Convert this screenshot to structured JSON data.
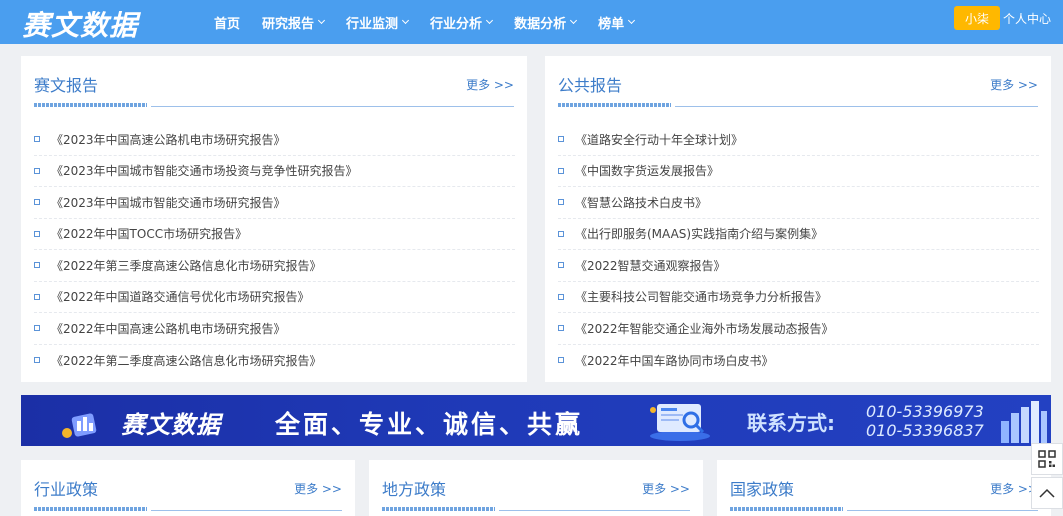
{
  "header": {
    "logo": "赛文数据",
    "nav": [
      {
        "label": "首页",
        "dropdown": false
      },
      {
        "label": "研究报告",
        "dropdown": true
      },
      {
        "label": "行业监测",
        "dropdown": true
      },
      {
        "label": "行业分析",
        "dropdown": true
      },
      {
        "label": "数据分析",
        "dropdown": true
      },
      {
        "label": "榜单",
        "dropdown": true
      }
    ],
    "user_button": "小柒",
    "user_center": "个人中心"
  },
  "sections": {
    "saiwen": {
      "title": "赛文报告",
      "more": "更多 >>",
      "items": [
        "《2023年中国高速公路机电市场研究报告》",
        "《2023年中国城市智能交通市场投资与竞争性研究报告》",
        "《2023年中国城市智能交通市场研究报告》",
        "《2022年中国TOCC市场研究报告》",
        "《2022年第三季度高速公路信息化市场研究报告》",
        "《2022年中国道路交通信号优化市场研究报告》",
        "《2022年中国高速公路机电市场研究报告》",
        "《2022年第二季度高速公路信息化市场研究报告》"
      ]
    },
    "public": {
      "title": "公共报告",
      "more": "更多 >>",
      "items": [
        "《道路安全行动十年全球计划》",
        "《中国数字货运发展报告》",
        "《智慧公路技术白皮书》",
        "《出行即服务(MAAS)实践指南介绍与案例集》",
        "《2022智慧交通观察报告》",
        "《主要科技公司智能交通市场竞争力分析报告》",
        "《2022年智能交通企业海外市场发展动态报告》",
        "《2022年中国车路协同市场白皮书》"
      ]
    },
    "industry_policy": {
      "title": "行业政策",
      "more": "更多 >>"
    },
    "local_policy": {
      "title": "地方政策",
      "more": "更多 >>"
    },
    "national_policy": {
      "title": "国家政策",
      "more": "更多 >>"
    }
  },
  "banner": {
    "brand": "赛文数据",
    "slogan": "全面、专业、诚信、共赢",
    "contact_label": "联系方式:",
    "phone1": "010-53396973",
    "phone2": "010-53396837"
  },
  "colors": {
    "header_bg": "#4a9eef",
    "accent": "#3d7cc9",
    "user_button": "#ffb800",
    "banner_bg": "#1f3ab8"
  },
  "side_tools": [
    "qr-code-icon",
    "back-to-top-icon"
  ]
}
